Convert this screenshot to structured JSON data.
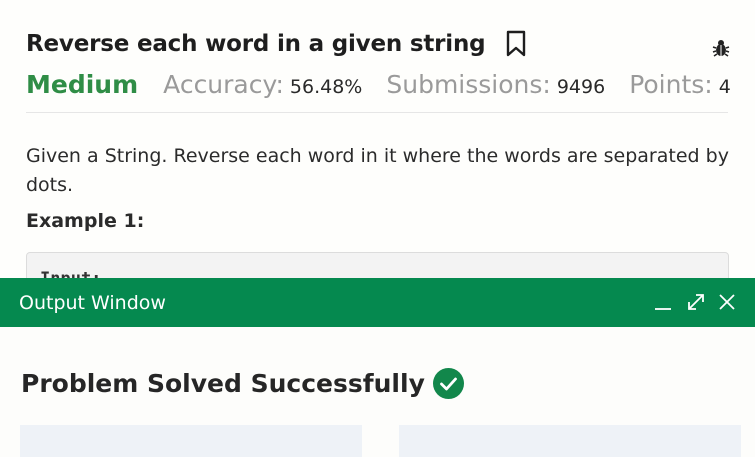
{
  "problem": {
    "title": "Reverse each word in a given string",
    "difficulty": "Medium",
    "accuracy_label": "Accuracy:",
    "accuracy_value": "56.48%",
    "submissions_label": "Submissions:",
    "submissions_value": "9496",
    "points_label": "Points:",
    "points_value": "4",
    "description": "Given a String. Reverse each word in it where the words are separated by dots.",
    "example_heading": "Example 1:",
    "example_first_line": "Input:"
  },
  "icons": {
    "bookmark": "bookmark-icon",
    "bug": "bug-icon",
    "minimize": "minimize-icon",
    "maximize": "maximize-icon",
    "close": "close-icon",
    "success": "check-circle-icon"
  },
  "output_window": {
    "title": "Output Window",
    "status": "Problem Solved Successfully"
  },
  "colors": {
    "accent": "#05894f",
    "difficulty": "#2f8d46",
    "success_icon": "#12874b",
    "panel_bg": "#eef2f7"
  }
}
